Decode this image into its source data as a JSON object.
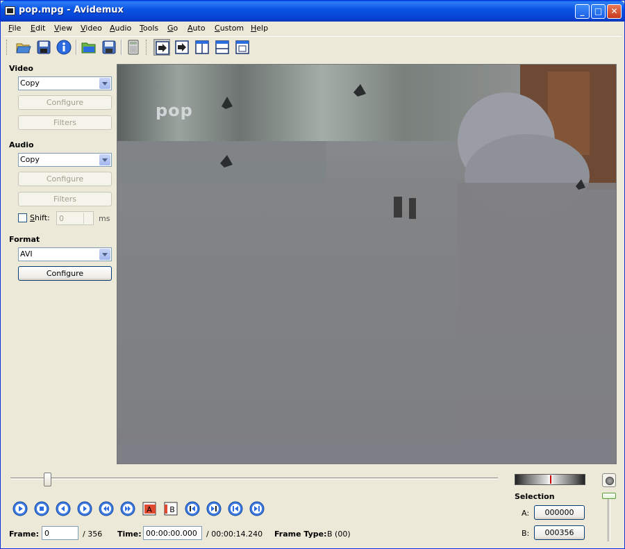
{
  "window": {
    "title": "pop.mpg - Avidemux",
    "minimize": "_",
    "maximize": "□",
    "close": "✕"
  },
  "menu": [
    "File",
    "Edit",
    "View",
    "Video",
    "Audio",
    "Tools",
    "Go",
    "Auto",
    "Custom",
    "Help"
  ],
  "toolbar": {
    "icons": [
      "open-icon",
      "save-icon",
      "info-icon",
      "open-folder-icon",
      "save-as-icon",
      "calculator-icon",
      "input-output-icon",
      "output-icon",
      "side-by-side-icon",
      "top-bottom-icon",
      "single-view-icon"
    ]
  },
  "video": {
    "section": "Video",
    "codec": "Copy",
    "configure": "Configure",
    "filters": "Filters"
  },
  "audio": {
    "section": "Audio",
    "codec": "Copy",
    "configure": "Configure",
    "filters": "Filters",
    "shift_label": "Shift:",
    "shift_value": "0",
    "shift_unit": "ms"
  },
  "format": {
    "section": "Format",
    "container": "AVI",
    "configure": "Configure"
  },
  "preview": {
    "logo": "pop"
  },
  "seek": {
    "position": 0.07
  },
  "navigation": {
    "icons": [
      "play-icon",
      "stop-icon",
      "previous-frame-icon",
      "next-frame-icon",
      "rewind-icon",
      "fast-forward-icon",
      "marker-a-icon",
      "marker-b-icon",
      "previous-keyframe-icon",
      "next-keyframe-icon",
      "first-frame-icon",
      "last-frame-icon"
    ],
    "marker_a": "A",
    "marker_b": "B"
  },
  "status": {
    "frame_label": "Frame:",
    "frame_value": "0",
    "frame_total": "/ 356",
    "time_label": "Time:",
    "time_value": "00:00:00.000",
    "time_total": "/ 00:00:14.240",
    "frametype_label": "Frame Type:",
    "frametype_value": "B (00)"
  },
  "selection": {
    "title": "Selection",
    "a_label": "A:",
    "a_value": "000000",
    "b_label": "B:",
    "b_value": "000356"
  },
  "colors": {
    "titlebar": "#0b55e5",
    "window_bg": "#ece9d8",
    "accent_blue": "#2b6de0"
  }
}
